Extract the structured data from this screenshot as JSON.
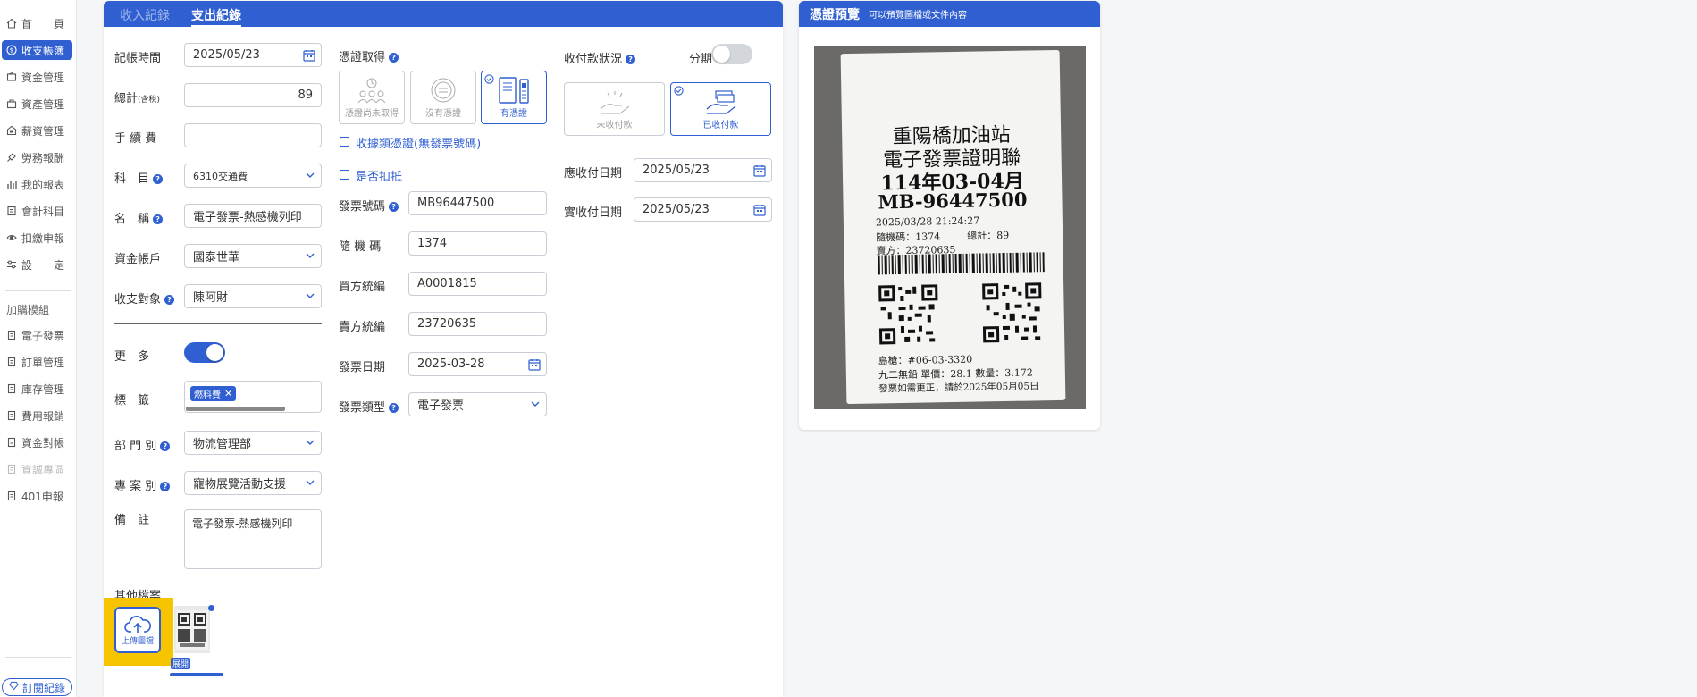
{
  "sidebar": {
    "items": [
      {
        "label": "首　　頁",
        "icon": "home-icon"
      },
      {
        "label": "收支帳簿",
        "icon": "money-icon",
        "active": true
      },
      {
        "label": "資金管理",
        "icon": "wallet-icon"
      },
      {
        "label": "資產管理",
        "icon": "asset-icon"
      },
      {
        "label": "薪資管理",
        "icon": "salary-icon"
      },
      {
        "label": "勞務報酬",
        "icon": "service-icon"
      },
      {
        "label": "我的報表",
        "icon": "chart-icon"
      },
      {
        "label": "會計科目",
        "icon": "ledger-icon"
      },
      {
        "label": "扣繳申報",
        "icon": "tax-icon"
      },
      {
        "label": "設　　定",
        "icon": "settings-icon"
      }
    ],
    "addon_heading": "加購模組",
    "addons": [
      {
        "label": "電子發票",
        "icon": "invoice-icon"
      },
      {
        "label": "訂單管理",
        "icon": "order-icon"
      },
      {
        "label": "庫存管理",
        "icon": "stock-icon"
      },
      {
        "label": "費用報銷",
        "icon": "expense-icon"
      },
      {
        "label": "資金對帳",
        "icon": "reconcile-icon"
      },
      {
        "label": "資誠專區",
        "icon": "zone-icon",
        "disabled": true
      },
      {
        "label": "401申報",
        "icon": "report-icon"
      }
    ],
    "bottom_label": "訂閱紀錄"
  },
  "tabs": {
    "income": "收入紀錄",
    "expense": "支出紀錄"
  },
  "form": {
    "date_label": "記帳時間",
    "date_value": "2025/05/23",
    "total_label": "總計",
    "total_tax": "(含稅)",
    "total_value": "89",
    "fee_label": "手 續 費",
    "fee_value": "",
    "subject_label": "科　目",
    "subject_value": "6310交通費",
    "name_label": "名　稱",
    "name_value": "電子發票-熱感機列印",
    "account_label": "資金帳戶",
    "account_value": "國泰世華",
    "party_label": "收支對象",
    "party_value": "陳阿財",
    "more_label": "更　多",
    "tags_label": "標　籤",
    "tag_value": "燃料費",
    "dept_label": "部 門 別",
    "dept_value": "物流管理部",
    "project_label": "專 案 別",
    "project_value": "寵物展覽活動支援",
    "note_label": "備　註",
    "note_value": "電子發票-熱感機列印",
    "files_label": "其他檔案",
    "upload_label": "上傳圖檔",
    "thumb_badge": "展開"
  },
  "voucher": {
    "label": "憑證取得",
    "options": [
      {
        "label": "憑證尚未取得",
        "selected": false
      },
      {
        "label": "沒有憑證",
        "selected": false
      },
      {
        "label": "有憑證",
        "selected": true
      }
    ],
    "receipt_type_label": "收據類憑證(無發票號碼)",
    "deduct_label": "是否扣抵",
    "invoice_no_label": "發票號碼",
    "invoice_no_value": "MB96447500",
    "random_label": "隨 機 碼",
    "random_value": "1374",
    "buyer_label": "買方統編",
    "buyer_value": "A0001815",
    "seller_label": "賣方統編",
    "seller_value": "23720635",
    "invoice_date_label": "發票日期",
    "invoice_date_value": "2025-03-28",
    "invoice_type_label": "發票類型",
    "invoice_type_value": "電子發票"
  },
  "payment": {
    "label": "收付款狀況",
    "installment_label": "分期",
    "options": [
      {
        "label": "未收付款",
        "selected": false
      },
      {
        "label": "已收付款",
        "selected": true
      }
    ],
    "due_label": "應收付日期",
    "due_value": "2025/05/23",
    "actual_label": "實收付日期",
    "actual_value": "2025/05/23"
  },
  "preview": {
    "title": "憑證預覽",
    "subtitle": "可以預覽圖檔或文件內容",
    "receipt": {
      "store": "重陽橋加油站",
      "doc_title": "電子發票證明聯",
      "period": "114年03-04月",
      "number": "MB-96447500",
      "datetime": "2025/03/28 21:24:27",
      "random": "隨機碼：1374",
      "total": "總計：89",
      "seller": "賣方：23720635",
      "pump": "島槍：#06-03-3320",
      "item": "九二無鉛 單價：28.1 數量：3.172",
      "notice": "發票如需更正，請於2025年05月05日"
    }
  },
  "colors": {
    "accent": "#2f5fd0",
    "highlight": "#f7c500"
  }
}
